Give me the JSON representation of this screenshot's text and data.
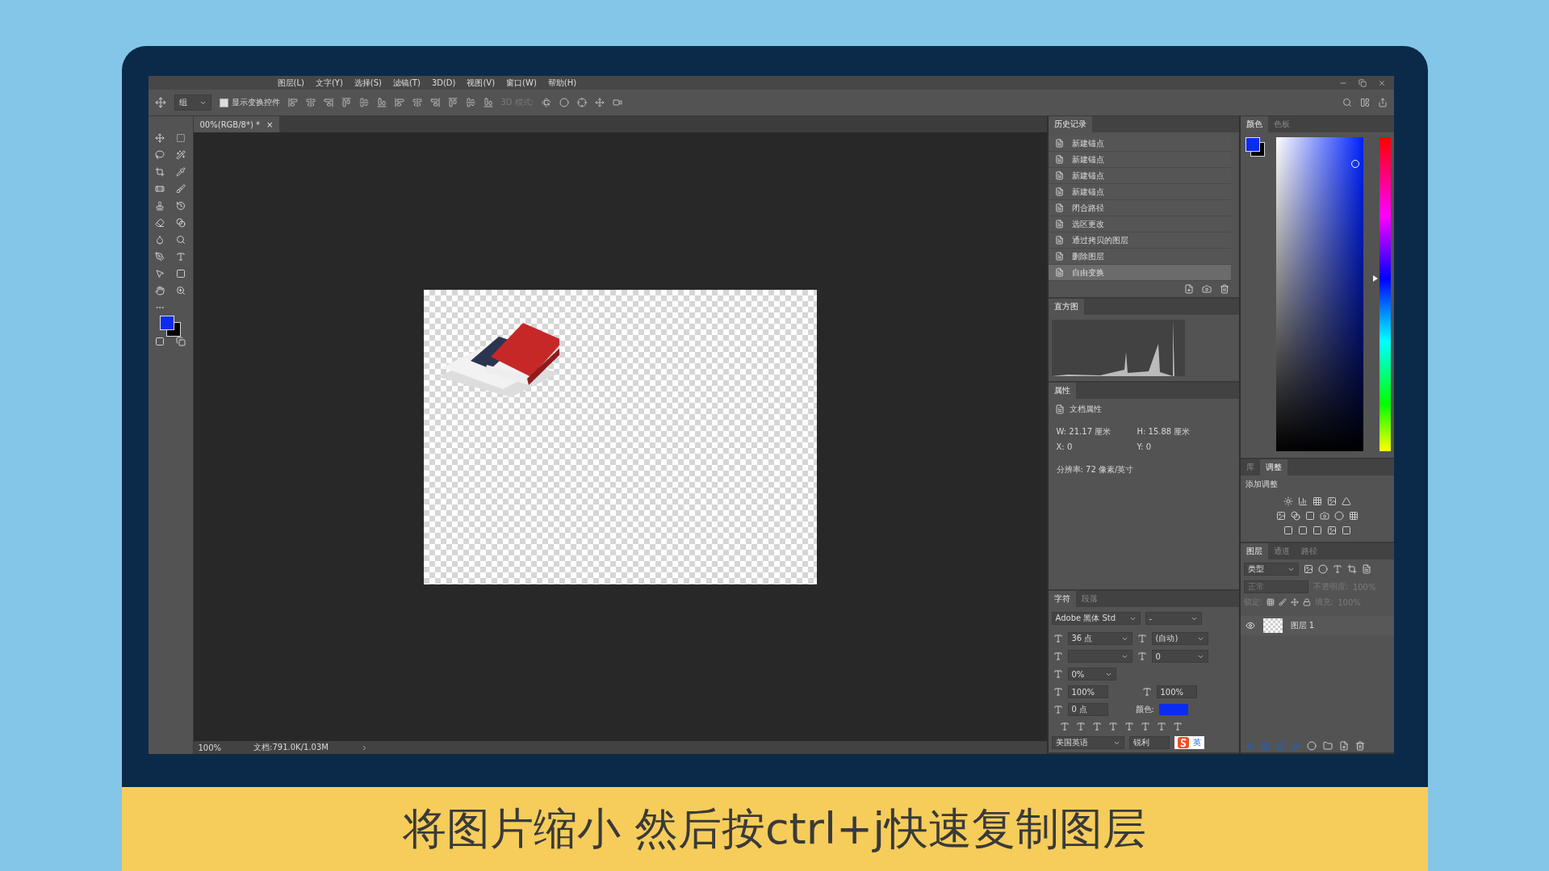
{
  "menu": [
    "图层(L)",
    "文字(Y)",
    "选择(S)",
    "滤镜(T)",
    "3D(D)",
    "视图(V)",
    "窗口(W)",
    "帮助(H)"
  ],
  "options": {
    "group_dropdown": "组",
    "show_transform": {
      "label": "显示变换控件",
      "checked": true
    },
    "mode_label": "3D 模式:"
  },
  "document_tab": {
    "title": "00%(RGB/8*) *",
    "close": "×"
  },
  "history": {
    "title": "历史记录",
    "items": [
      {
        "label": "新建锚点",
        "selected": false
      },
      {
        "label": "新建锚点",
        "selected": false
      },
      {
        "label": "新建锚点",
        "selected": false
      },
      {
        "label": "新建锚点",
        "selected": false
      },
      {
        "label": "闭合路径",
        "selected": false
      },
      {
        "label": "选区更改",
        "selected": false
      },
      {
        "label": "通过拷贝的图层",
        "selected": false
      },
      {
        "label": "删除图层",
        "selected": false
      },
      {
        "label": "自由变换",
        "selected": true
      }
    ]
  },
  "histogram": {
    "title": "直方图"
  },
  "properties": {
    "title": "属性",
    "heading": "文档属性",
    "fields": [
      {
        "label": "W:",
        "value": "21.17 厘米"
      },
      {
        "label": "H:",
        "value": "15.88 厘米"
      },
      {
        "label": "X:",
        "value": "0"
      },
      {
        "label": "Y:",
        "value": "0"
      }
    ],
    "resolution": "分辨率: 72 像素/英寸"
  },
  "character": {
    "tabs": [
      {
        "label": "字符",
        "selected": true
      },
      {
        "label": "段落",
        "selected": false
      }
    ],
    "font": "Adobe 黑体 Std",
    "style": "-",
    "size": "36 点",
    "leading": "(自动)",
    "tracking": "0",
    "tsume": "0%",
    "vscale": "100%",
    "hscale": "100%",
    "baseline": "0 点",
    "color_label": "颜色:",
    "color": "#0a2cf0",
    "language": "美国英语",
    "antialias": "锐利"
  },
  "color_panel": {
    "tabs": [
      {
        "label": "颜色",
        "selected": true
      },
      {
        "label": "色板",
        "selected": false
      }
    ]
  },
  "adjustments": {
    "tabs": [
      {
        "label": "库",
        "selected": false
      },
      {
        "label": "调整",
        "selected": true
      }
    ],
    "title": "添加调整"
  },
  "layers": {
    "tabs": [
      {
        "label": "图层",
        "selected": true
      },
      {
        "label": "通道",
        "selected": false
      },
      {
        "label": "路径",
        "selected": false
      }
    ],
    "filter": "类型",
    "blend_mode": "正常",
    "opacity_label": "不透明度:",
    "opacity": "100%",
    "lock_label": "锁定:",
    "fill_label": "填充:",
    "fill": "100%",
    "items": [
      {
        "name": "图层 1",
        "visible": true
      }
    ]
  },
  "status": {
    "zoom": "100%",
    "doc": "文档:791.0K/1.03M"
  },
  "ime": {
    "label": "英"
  },
  "caption": "将图片缩小 然后按ctrl+j快速复制图层"
}
